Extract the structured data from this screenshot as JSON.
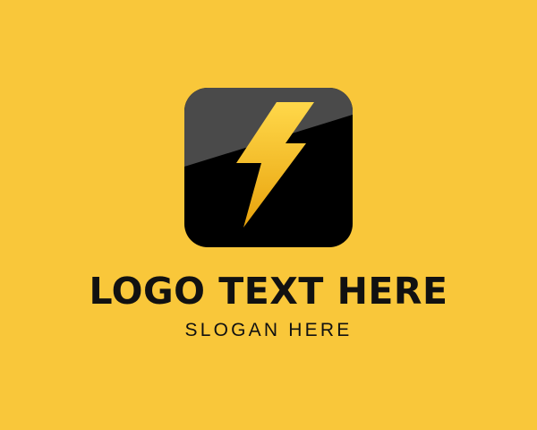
{
  "colors": {
    "background": "#F9C73A",
    "tile_top": "#4A4A4A",
    "tile_bottom": "#000000",
    "bolt_light": "#FFD84A",
    "bolt_dark": "#E8A20C",
    "text": "#111111"
  },
  "logo": {
    "icon": "lightning-bolt-icon",
    "title": "LOGO TEXT HERE",
    "slogan": "SLOGAN HERE"
  }
}
